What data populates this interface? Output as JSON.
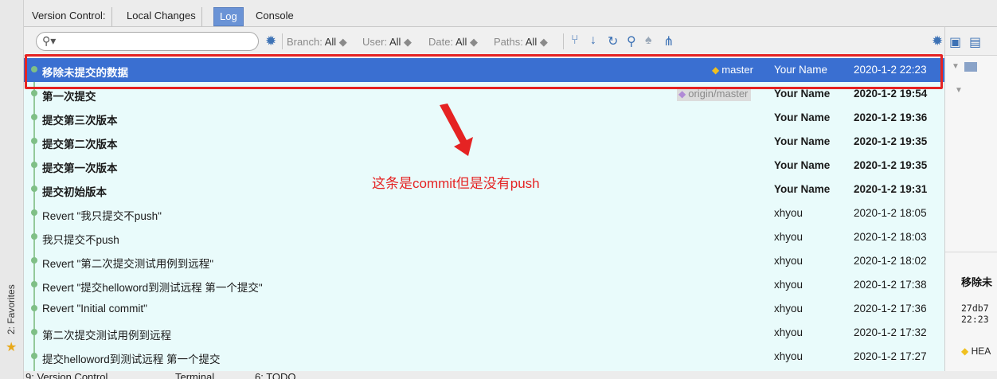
{
  "tabs": {
    "label": "Version Control:",
    "items": [
      "Local Changes",
      "Log",
      "Console"
    ]
  },
  "toolbar": {
    "search_value": "",
    "filters": [
      {
        "label": "Branch:",
        "value": "All"
      },
      {
        "label": "User:",
        "value": "All"
      },
      {
        "label": "Date:",
        "value": "All"
      },
      {
        "label": "Paths:",
        "value": "All"
      }
    ],
    "icons": [
      "gear-icon",
      "branches-icon",
      "down-arrow-icon",
      "refresh-icon",
      "search-icon",
      "cherry-pick-icon",
      "tree-icon",
      "gear-icon",
      "lock-icon"
    ]
  },
  "refs": {
    "master": "master",
    "origin": "origin/master"
  },
  "commits": [
    {
      "message": "移除未提交的数据",
      "author": "Your Name",
      "date": "2020-1-2 22:23"
    },
    {
      "message": "第一次提交",
      "author": "Your Name",
      "date": "2020-1-2 19:54"
    },
    {
      "message": "提交第三次版本",
      "author": "Your Name",
      "date": "2020-1-2 19:36"
    },
    {
      "message": "提交第二次版本",
      "author": "Your Name",
      "date": "2020-1-2 19:35"
    },
    {
      "message": "提交第一次版本",
      "author": "Your Name",
      "date": "2020-1-2 19:35"
    },
    {
      "message": "提交初始版本",
      "author": "Your Name",
      "date": "2020-1-2 19:31"
    },
    {
      "message": "Revert \"我只提交不push\"",
      "author": "xhyou",
      "date": "2020-1-2 18:05"
    },
    {
      "message": "我只提交不push",
      "author": "xhyou",
      "date": "2020-1-2 18:03"
    },
    {
      "message": "Revert \"第二次提交测试用例到远程\"",
      "author": "xhyou",
      "date": "2020-1-2 18:02"
    },
    {
      "message": "Revert \"提交helloword到测试远程 第一个提交\"",
      "author": "xhyou",
      "date": "2020-1-2 17:38"
    },
    {
      "message": "Revert \"Initial commit\"",
      "author": "xhyou",
      "date": "2020-1-2 17:36"
    },
    {
      "message": "第二次提交测试用例到远程",
      "author": "xhyou",
      "date": "2020-1-2 17:32"
    },
    {
      "message": "提交helloword到测试远程 第一个提交",
      "author": "xhyou",
      "date": "2020-1-2 17:27"
    }
  ],
  "annotation": "这条是commit但是没有push",
  "details": {
    "title": "移除未",
    "hash": "27db7\n22:23",
    "head": "HEA"
  },
  "sidebar": {
    "favorites": "2: Favorites"
  },
  "bottom_tabs": [
    "9: Version Control",
    "Terminal",
    "6: TODO"
  ],
  "colors": {
    "selected_row": "#3a6fd1",
    "log_background": "#e9fbfb",
    "annotation_red": "#e52323",
    "graph_green": "#7fbf86"
  }
}
